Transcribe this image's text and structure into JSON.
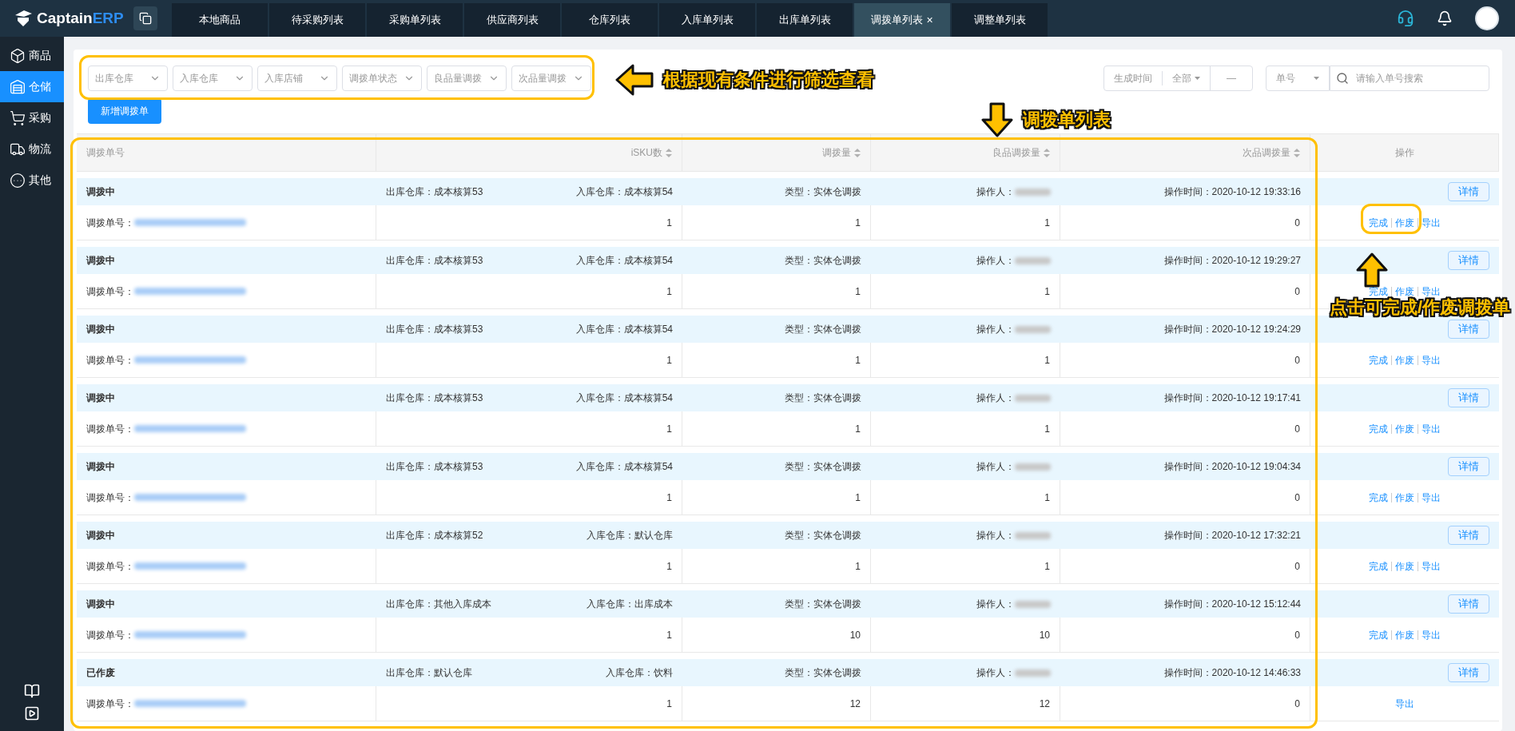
{
  "app": {
    "logo_main": "Captain",
    "logo_accent": "ERP"
  },
  "nav_tabs": [
    {
      "label": "本地商品",
      "selected": false
    },
    {
      "label": "待采购列表",
      "selected": false
    },
    {
      "label": "采购单列表",
      "selected": false
    },
    {
      "label": "供应商列表",
      "selected": false
    },
    {
      "label": "仓库列表",
      "selected": false
    },
    {
      "label": "入库单列表",
      "selected": false
    },
    {
      "label": "出库单列表",
      "selected": false
    },
    {
      "label": "调拨单列表",
      "selected": true,
      "close": "×"
    },
    {
      "label": "调整单列表",
      "selected": false
    }
  ],
  "sidebar": {
    "items": [
      {
        "label": "商品",
        "kind": "box",
        "selected": false
      },
      {
        "label": "仓储",
        "kind": "warehouse",
        "selected": true
      },
      {
        "label": "采购",
        "kind": "cart",
        "selected": false
      },
      {
        "label": "物流",
        "kind": "truck",
        "selected": false
      },
      {
        "label": "其他",
        "kind": "more",
        "selected": false
      }
    ]
  },
  "filters": [
    {
      "placeholder": "出库仓库"
    },
    {
      "placeholder": "入库仓库"
    },
    {
      "placeholder": "入库店铺"
    },
    {
      "placeholder": "调拨单状态"
    },
    {
      "placeholder": "良品量调拨"
    },
    {
      "placeholder": "次品量调拨"
    }
  ],
  "date_filter": {
    "label": "生成时间",
    "range": "全部",
    "separator": "—"
  },
  "search": {
    "type": "单号",
    "placeholder": "请输入单号搜索"
  },
  "new_button": "新增调拨单",
  "table": {
    "columns": [
      {
        "label": "调拨单号",
        "sortable": false
      },
      {
        "label": "iSKU数",
        "sortable": true
      },
      {
        "label": "调拨量",
        "sortable": true
      },
      {
        "label": "良品调拨量",
        "sortable": true
      },
      {
        "label": "次品调拨量",
        "sortable": true
      },
      {
        "label": "操作",
        "sortable": false
      }
    ],
    "groups": [
      {
        "status": "调拨中",
        "out_warehouse": "出库仓库：成本核算53",
        "in_warehouse": "入库仓库：成本核算54",
        "type": "类型：实体仓调拨",
        "operator": "操作人：",
        "time": "操作时间：2020-10-12 19:33:16",
        "detail": "详情",
        "order_label": "调拨单号：",
        "isku": "1",
        "qty": "1",
        "good_qty": "1",
        "bad_qty": "0",
        "actions": [
          "完成",
          "作废",
          "导出"
        ]
      },
      {
        "status": "调拨中",
        "out_warehouse": "出库仓库：成本核算53",
        "in_warehouse": "入库仓库：成本核算54",
        "type": "类型：实体仓调拨",
        "operator": "操作人：",
        "time": "操作时间：2020-10-12 19:29:27",
        "detail": "详情",
        "order_label": "调拨单号：",
        "isku": "1",
        "qty": "1",
        "good_qty": "1",
        "bad_qty": "0",
        "actions": [
          "完成",
          "作废",
          "导出"
        ]
      },
      {
        "status": "调拨中",
        "out_warehouse": "出库仓库：成本核算53",
        "in_warehouse": "入库仓库：成本核算54",
        "type": "类型：实体仓调拨",
        "operator": "操作人：",
        "time": "操作时间：2020-10-12 19:24:29",
        "detail": "详情",
        "order_label": "调拨单号：",
        "isku": "1",
        "qty": "1",
        "good_qty": "1",
        "bad_qty": "0",
        "actions": [
          "完成",
          "作废",
          "导出"
        ]
      },
      {
        "status": "调拨中",
        "out_warehouse": "出库仓库：成本核算53",
        "in_warehouse": "入库仓库：成本核算54",
        "type": "类型：实体仓调拨",
        "operator": "操作人：",
        "time": "操作时间：2020-10-12 19:17:41",
        "detail": "详情",
        "order_label": "调拨单号：",
        "isku": "1",
        "qty": "1",
        "good_qty": "1",
        "bad_qty": "0",
        "actions": [
          "完成",
          "作废",
          "导出"
        ]
      },
      {
        "status": "调拨中",
        "out_warehouse": "出库仓库：成本核算53",
        "in_warehouse": "入库仓库：成本核算54",
        "type": "类型：实体仓调拨",
        "operator": "操作人：",
        "time": "操作时间：2020-10-12 19:04:34",
        "detail": "详情",
        "order_label": "调拨单号：",
        "isku": "1",
        "qty": "1",
        "good_qty": "1",
        "bad_qty": "0",
        "actions": [
          "完成",
          "作废",
          "导出"
        ]
      },
      {
        "status": "调拨中",
        "out_warehouse": "出库仓库：成本核算52",
        "in_warehouse": "入库仓库：默认仓库",
        "type": "类型：实体仓调拨",
        "operator": "操作人：",
        "time": "操作时间：2020-10-12 17:32:21",
        "detail": "详情",
        "order_label": "调拨单号：",
        "isku": "1",
        "qty": "1",
        "good_qty": "1",
        "bad_qty": "0",
        "actions": [
          "完成",
          "作废",
          "导出"
        ]
      },
      {
        "status": "调拨中",
        "out_warehouse": "出库仓库：其他入库成本",
        "in_warehouse": "入库仓库：出库成本",
        "type": "类型：实体仓调拨",
        "operator": "操作人：",
        "time": "操作时间：2020-10-12 15:12:44",
        "detail": "详情",
        "order_label": "调拨单号：",
        "isku": "1",
        "qty": "10",
        "good_qty": "10",
        "bad_qty": "0",
        "actions": [
          "完成",
          "作废",
          "导出"
        ]
      },
      {
        "status": "已作废",
        "out_warehouse": "出库仓库：默认仓库",
        "in_warehouse": "入库仓库：饮料",
        "type": "类型：实体仓调拨",
        "operator": "操作人：",
        "time": "操作时间：2020-10-12 14:46:33",
        "detail": "详情",
        "order_label": "调拨单号：",
        "isku": "1",
        "qty": "12",
        "good_qty": "12",
        "bad_qty": "0",
        "actions": [
          "导出"
        ]
      }
    ]
  },
  "annotations": [
    {
      "text": "根据现有条件进行筛选查看",
      "kind": "left"
    },
    {
      "text": "调拨单列表",
      "kind": "down"
    },
    {
      "text": "点击可完成/作废调拨单",
      "kind": "up"
    }
  ]
}
